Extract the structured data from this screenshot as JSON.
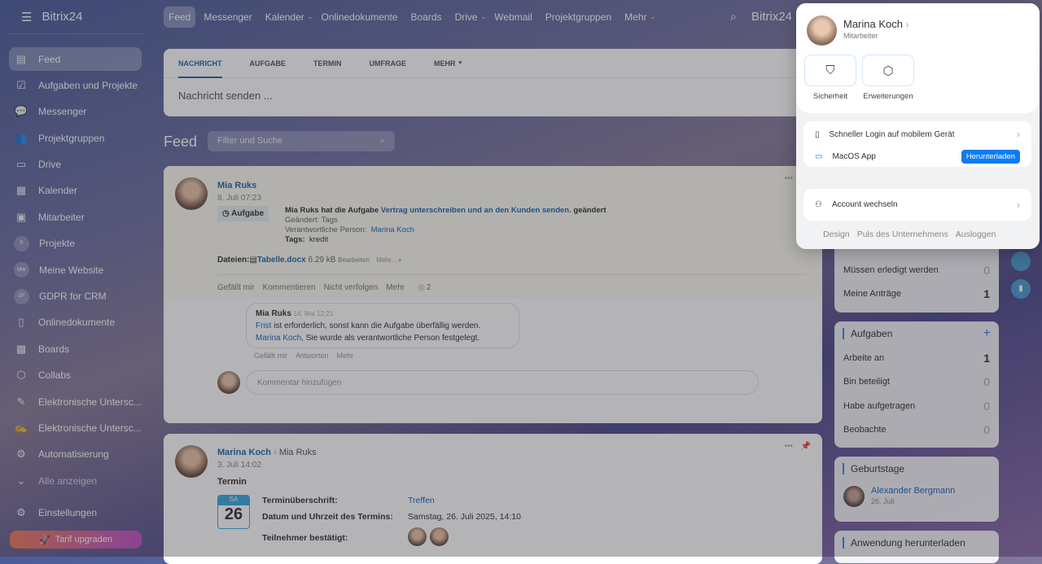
{
  "sidebar": {
    "logo": "Bitrix24",
    "items": [
      {
        "label": "Feed",
        "icon": "feed-icon",
        "glyph": "▤"
      },
      {
        "label": "Aufgaben und Projekte",
        "icon": "tasks-icon",
        "glyph": "☑"
      },
      {
        "label": "Messenger",
        "icon": "chat-icon",
        "glyph": "💬"
      },
      {
        "label": "Projektgruppen",
        "icon": "groups-icon",
        "glyph": "👥"
      },
      {
        "label": "Drive",
        "icon": "drive-icon",
        "glyph": "▭"
      },
      {
        "label": "Kalender",
        "icon": "calendar-icon",
        "glyph": "▦"
      },
      {
        "label": "Mitarbeiter",
        "icon": "employees-icon",
        "glyph": "▣"
      },
      {
        "label": "Projekte",
        "icon": "P",
        "circle": true
      },
      {
        "label": "Meine Website",
        "icon": "MW",
        "circle": true
      },
      {
        "label": "GDPR for CRM",
        "icon": "GF",
        "circle": true
      },
      {
        "label": "Onlinedokumente",
        "icon": "document-icon",
        "glyph": "▯"
      },
      {
        "label": "Boards",
        "icon": "boards-icon",
        "glyph": "▩"
      },
      {
        "label": "Collabs",
        "icon": "collabs-icon",
        "glyph": "⬡"
      },
      {
        "label": "Elektronische Untersc...",
        "icon": "esign-doc-icon",
        "glyph": "✎"
      },
      {
        "label": "Elektronische Untersc...",
        "icon": "signature-icon",
        "glyph": "✍"
      },
      {
        "label": "Automatisierung",
        "icon": "robot-icon",
        "glyph": "⚙"
      },
      {
        "label": "Alle anzeigen",
        "icon": "chevron-down-icon",
        "glyph": "⌄"
      }
    ],
    "settings": "Einstellungen",
    "upgrade": "Tarif upgraden"
  },
  "topbar": {
    "items": [
      "Feed",
      "Messenger",
      "Kalender",
      "Onlinedokumente",
      "Boards",
      "Drive",
      "Webmail",
      "Projektgruppen",
      "Mehr"
    ],
    "dropdowns": [
      false,
      false,
      true,
      false,
      false,
      true,
      false,
      false,
      true
    ],
    "brand": "Bitrix24"
  },
  "composer": {
    "tabs": [
      "NACHRICHT",
      "AUFGABE",
      "TERMIN",
      "UMFRAGE",
      "MEHR"
    ],
    "placeholder": "Nachricht senden ..."
  },
  "feed": {
    "title": "Feed",
    "search_placeholder": "Filter und Suche"
  },
  "post1": {
    "author": "Mia Ruks",
    "date": "8. Juli 07:23",
    "badge": "Aufgabe",
    "text_pre": "Mia Ruks hat die Aufgabe ",
    "task_link": "Vertrag unterschreiben und an den Kunden senden.",
    "text_post": " geändert",
    "changed_label": "Geändert:",
    "changed_value": "Tags",
    "resp_label": "Verantwortliche Person:",
    "resp_value": "Marina Koch",
    "tags_label": "Tags:",
    "tags_value": "kredit",
    "files_label": "Dateien:",
    "file_name": "Tabelle.docx",
    "file_size": "6.29 kB",
    "edit": "Bearbeiten",
    "more": "Mehr...",
    "actions": [
      "Gefällt mir",
      "Kommentieren",
      "Nicht verfolgen",
      "Mehr"
    ],
    "views": "2",
    "comment": {
      "author": "Mia Ruks",
      "date": "14. Mai 12:21",
      "link1": "Frist",
      "text1": " ist erforderlich, sonst kann die Aufgabe überfällig werden.",
      "link2": "Marina Koch",
      "text2": ", Sie wurde als verantwortliche Person festgelegt.",
      "actions": [
        "Gefällt mir",
        "Antworten",
        "Mehr"
      ]
    },
    "comment_placeholder": "Kommentar hinzufügen"
  },
  "post2": {
    "author": "Marina Koch",
    "recipient": "Mia Ruks",
    "date": "3. Juli 14:02",
    "type": "Termin",
    "cal_day": "SA",
    "cal_num": "26",
    "f1_label": "Terminüberschrift:",
    "f1_value": "Treffen",
    "f2_label": "Datum und Uhrzeit des Termins:",
    "f2_value": "Samstag, 26. Juli 2025, 14:10",
    "f3_label": "Teilnehmer bestätigt:"
  },
  "widgets": {
    "requests": [
      {
        "label": "Müssen erledigt werden",
        "count": "0"
      },
      {
        "label": "Meine Anträge",
        "count": "1"
      }
    ],
    "tasks_title": "Aufgaben",
    "tasks": [
      {
        "label": "Arbeite an",
        "count": "1"
      },
      {
        "label": "Bin beteiligt",
        "count": "0"
      },
      {
        "label": "Habe aufgetragen",
        "count": "0"
      },
      {
        "label": "Beobachte",
        "count": "0"
      }
    ],
    "birthdays_title": "Geburtstage",
    "birthday_name": "Alexander Bergmann",
    "birthday_date": "26. Juli",
    "download_title": "Anwendung herunterladen"
  },
  "popup": {
    "name": "Marina Koch",
    "role": "Mitarbeiter",
    "security": "Sicherheit",
    "extensions": "Erweiterungen",
    "mobile_login": "Schneller Login auf mobilem Gerät",
    "macos": "MacOS App",
    "download": "Herunterladen",
    "switch": "Account wechseln",
    "footer": [
      "Design",
      "Puls des Unternehmens",
      "Ausloggen"
    ]
  },
  "colors": {
    "accent": "#2067b0",
    "button": "#0b7cf5"
  }
}
